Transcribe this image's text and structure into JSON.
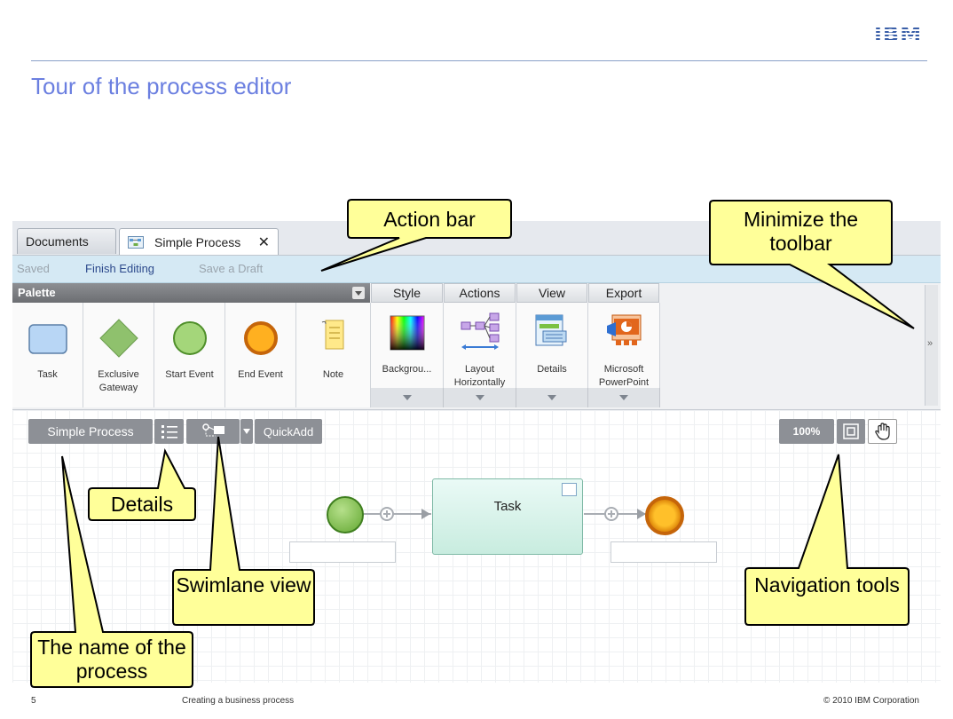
{
  "slide": {
    "logo": "IBM",
    "title": "Tour of the process editor",
    "slide_number": "5",
    "footer": "Creating a business process",
    "copyright": "© 2010 IBM Corporation"
  },
  "tabs": {
    "documents": "Documents",
    "simple_process": "Simple Process",
    "close": "✕"
  },
  "action_bar": {
    "saved": "Saved",
    "finish_editing": "Finish Editing",
    "save_draft": "Save a Draft"
  },
  "palette": {
    "header": "Palette",
    "items": [
      {
        "label": "Task"
      },
      {
        "label": "Exclusive Gateway"
      },
      {
        "label": "Start Event"
      },
      {
        "label": "End Event"
      },
      {
        "label": "Note"
      }
    ]
  },
  "ribbon": {
    "groups": [
      {
        "header": "Style",
        "item": "Backgrou..."
      },
      {
        "header": "Actions",
        "item": "Layout Horizontally"
      },
      {
        "header": "View",
        "item": "Details"
      },
      {
        "header": "Export",
        "item": "Microsoft PowerPoint"
      }
    ],
    "collapse": "»"
  },
  "canvas": {
    "process_name": "Simple Process",
    "quickadd": "QuickAdd",
    "zoom": "100%",
    "task_label": "Task"
  },
  "callouts": {
    "action_bar": "Action bar",
    "minimize": "Minimize the toolbar",
    "details": "Details",
    "swimlane": "Swimlane view",
    "navigation": "Navigation tools",
    "process_name": "The name of the process"
  },
  "colors": {
    "callout_fill": "#ffff99",
    "title": "#6b7fe0",
    "action_bar": "#d5e9f4"
  }
}
